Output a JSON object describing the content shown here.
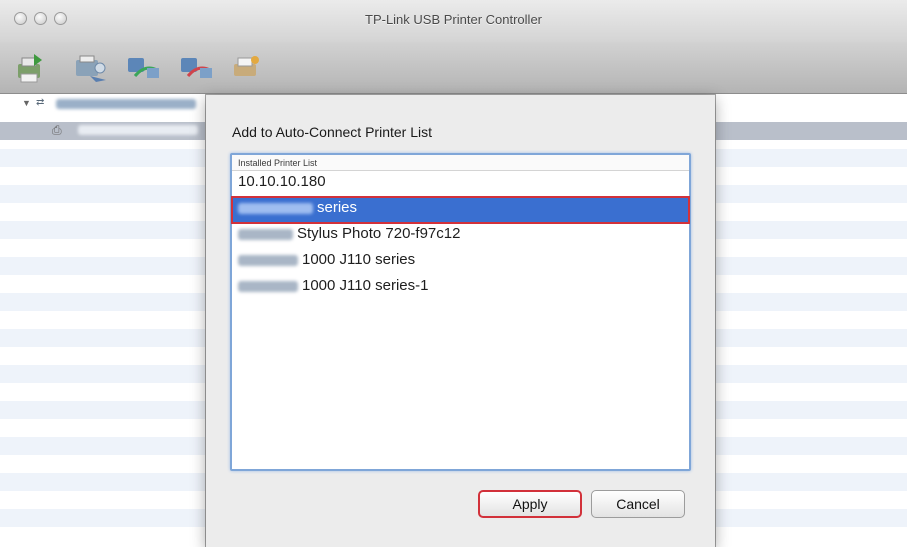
{
  "window": {
    "title": "TP-Link USB Printer Controller"
  },
  "toolbar": {
    "tools": [
      {
        "icon": "printer-green-icon"
      },
      {
        "icon": "auto-connect-icon"
      },
      {
        "icon": "network-connect-icon"
      },
      {
        "icon": "network-disconnect-icon"
      },
      {
        "icon": "printer-settings-icon"
      }
    ]
  },
  "dialog": {
    "title": "Add to Auto-Connect Printer List",
    "list_header": "Installed Printer List",
    "printers": [
      {
        "prefix": "",
        "label": "10.10.10.180",
        "selected": false
      },
      {
        "prefix": "redacted",
        "label": "series",
        "selected": true
      },
      {
        "prefix": "redacted",
        "label": "Stylus Photo 720-f97c12",
        "selected": false
      },
      {
        "prefix": "redacted",
        "label": "1000 J110 series",
        "selected": false
      },
      {
        "prefix": "redacted",
        "label": "1000 J110 series-1",
        "selected": false
      }
    ],
    "apply_label": "Apply",
    "cancel_label": "Cancel"
  },
  "colors": {
    "selection": "#3a6fd0",
    "highlight_box": "#d2313a",
    "stripe": "#eef3fa"
  }
}
